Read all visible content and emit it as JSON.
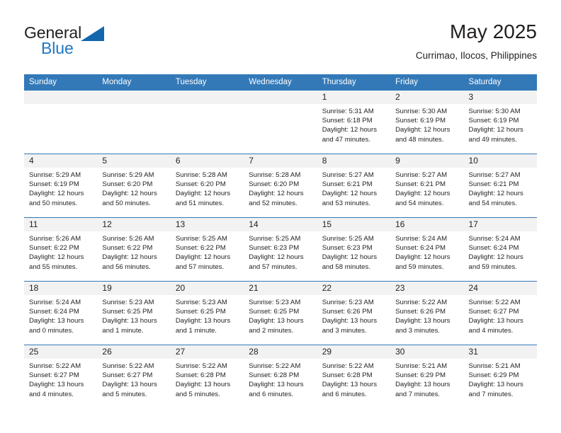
{
  "logo": {
    "word1": "General",
    "word2": "Blue",
    "accent_color": "#1267ad",
    "triangle_icon": "logo-triangle-icon"
  },
  "header": {
    "title": "May 2025",
    "subtitle": "Currimao, Ilocos, Philippines"
  },
  "calendar": {
    "header_bg": "#3379b8",
    "daynum_bg": "#f2f2f2",
    "weekday_headers": [
      "Sunday",
      "Monday",
      "Tuesday",
      "Wednesday",
      "Thursday",
      "Friday",
      "Saturday"
    ],
    "labels": {
      "sunrise": "Sunrise:",
      "sunset": "Sunset:",
      "daylight": "Daylight:"
    },
    "weeks": [
      [
        {
          "day": "",
          "empty": true
        },
        {
          "day": "",
          "empty": true
        },
        {
          "day": "",
          "empty": true
        },
        {
          "day": "",
          "empty": true
        },
        {
          "day": "1",
          "sunrise": "Sunrise: 5:31 AM",
          "sunset": "Sunset: 6:18 PM",
          "daylight1": "Daylight: 12 hours",
          "daylight2": "and 47 minutes."
        },
        {
          "day": "2",
          "sunrise": "Sunrise: 5:30 AM",
          "sunset": "Sunset: 6:19 PM",
          "daylight1": "Daylight: 12 hours",
          "daylight2": "and 48 minutes."
        },
        {
          "day": "3",
          "sunrise": "Sunrise: 5:30 AM",
          "sunset": "Sunset: 6:19 PM",
          "daylight1": "Daylight: 12 hours",
          "daylight2": "and 49 minutes."
        }
      ],
      [
        {
          "day": "4",
          "sunrise": "Sunrise: 5:29 AM",
          "sunset": "Sunset: 6:19 PM",
          "daylight1": "Daylight: 12 hours",
          "daylight2": "and 50 minutes."
        },
        {
          "day": "5",
          "sunrise": "Sunrise: 5:29 AM",
          "sunset": "Sunset: 6:20 PM",
          "daylight1": "Daylight: 12 hours",
          "daylight2": "and 50 minutes."
        },
        {
          "day": "6",
          "sunrise": "Sunrise: 5:28 AM",
          "sunset": "Sunset: 6:20 PM",
          "daylight1": "Daylight: 12 hours",
          "daylight2": "and 51 minutes."
        },
        {
          "day": "7",
          "sunrise": "Sunrise: 5:28 AM",
          "sunset": "Sunset: 6:20 PM",
          "daylight1": "Daylight: 12 hours",
          "daylight2": "and 52 minutes."
        },
        {
          "day": "8",
          "sunrise": "Sunrise: 5:27 AM",
          "sunset": "Sunset: 6:21 PM",
          "daylight1": "Daylight: 12 hours",
          "daylight2": "and 53 minutes."
        },
        {
          "day": "9",
          "sunrise": "Sunrise: 5:27 AM",
          "sunset": "Sunset: 6:21 PM",
          "daylight1": "Daylight: 12 hours",
          "daylight2": "and 54 minutes."
        },
        {
          "day": "10",
          "sunrise": "Sunrise: 5:27 AM",
          "sunset": "Sunset: 6:21 PM",
          "daylight1": "Daylight: 12 hours",
          "daylight2": "and 54 minutes."
        }
      ],
      [
        {
          "day": "11",
          "sunrise": "Sunrise: 5:26 AM",
          "sunset": "Sunset: 6:22 PM",
          "daylight1": "Daylight: 12 hours",
          "daylight2": "and 55 minutes."
        },
        {
          "day": "12",
          "sunrise": "Sunrise: 5:26 AM",
          "sunset": "Sunset: 6:22 PM",
          "daylight1": "Daylight: 12 hours",
          "daylight2": "and 56 minutes."
        },
        {
          "day": "13",
          "sunrise": "Sunrise: 5:25 AM",
          "sunset": "Sunset: 6:22 PM",
          "daylight1": "Daylight: 12 hours",
          "daylight2": "and 57 minutes."
        },
        {
          "day": "14",
          "sunrise": "Sunrise: 5:25 AM",
          "sunset": "Sunset: 6:23 PM",
          "daylight1": "Daylight: 12 hours",
          "daylight2": "and 57 minutes."
        },
        {
          "day": "15",
          "sunrise": "Sunrise: 5:25 AM",
          "sunset": "Sunset: 6:23 PM",
          "daylight1": "Daylight: 12 hours",
          "daylight2": "and 58 minutes."
        },
        {
          "day": "16",
          "sunrise": "Sunrise: 5:24 AM",
          "sunset": "Sunset: 6:24 PM",
          "daylight1": "Daylight: 12 hours",
          "daylight2": "and 59 minutes."
        },
        {
          "day": "17",
          "sunrise": "Sunrise: 5:24 AM",
          "sunset": "Sunset: 6:24 PM",
          "daylight1": "Daylight: 12 hours",
          "daylight2": "and 59 minutes."
        }
      ],
      [
        {
          "day": "18",
          "sunrise": "Sunrise: 5:24 AM",
          "sunset": "Sunset: 6:24 PM",
          "daylight1": "Daylight: 13 hours",
          "daylight2": "and 0 minutes."
        },
        {
          "day": "19",
          "sunrise": "Sunrise: 5:23 AM",
          "sunset": "Sunset: 6:25 PM",
          "daylight1": "Daylight: 13 hours",
          "daylight2": "and 1 minute."
        },
        {
          "day": "20",
          "sunrise": "Sunrise: 5:23 AM",
          "sunset": "Sunset: 6:25 PM",
          "daylight1": "Daylight: 13 hours",
          "daylight2": "and 1 minute."
        },
        {
          "day": "21",
          "sunrise": "Sunrise: 5:23 AM",
          "sunset": "Sunset: 6:25 PM",
          "daylight1": "Daylight: 13 hours",
          "daylight2": "and 2 minutes."
        },
        {
          "day": "22",
          "sunrise": "Sunrise: 5:23 AM",
          "sunset": "Sunset: 6:26 PM",
          "daylight1": "Daylight: 13 hours",
          "daylight2": "and 3 minutes."
        },
        {
          "day": "23",
          "sunrise": "Sunrise: 5:22 AM",
          "sunset": "Sunset: 6:26 PM",
          "daylight1": "Daylight: 13 hours",
          "daylight2": "and 3 minutes."
        },
        {
          "day": "24",
          "sunrise": "Sunrise: 5:22 AM",
          "sunset": "Sunset: 6:27 PM",
          "daylight1": "Daylight: 13 hours",
          "daylight2": "and 4 minutes."
        }
      ],
      [
        {
          "day": "25",
          "sunrise": "Sunrise: 5:22 AM",
          "sunset": "Sunset: 6:27 PM",
          "daylight1": "Daylight: 13 hours",
          "daylight2": "and 4 minutes."
        },
        {
          "day": "26",
          "sunrise": "Sunrise: 5:22 AM",
          "sunset": "Sunset: 6:27 PM",
          "daylight1": "Daylight: 13 hours",
          "daylight2": "and 5 minutes."
        },
        {
          "day": "27",
          "sunrise": "Sunrise: 5:22 AM",
          "sunset": "Sunset: 6:28 PM",
          "daylight1": "Daylight: 13 hours",
          "daylight2": "and 5 minutes."
        },
        {
          "day": "28",
          "sunrise": "Sunrise: 5:22 AM",
          "sunset": "Sunset: 6:28 PM",
          "daylight1": "Daylight: 13 hours",
          "daylight2": "and 6 minutes."
        },
        {
          "day": "29",
          "sunrise": "Sunrise: 5:22 AM",
          "sunset": "Sunset: 6:28 PM",
          "daylight1": "Daylight: 13 hours",
          "daylight2": "and 6 minutes."
        },
        {
          "day": "30",
          "sunrise": "Sunrise: 5:21 AM",
          "sunset": "Sunset: 6:29 PM",
          "daylight1": "Daylight: 13 hours",
          "daylight2": "and 7 minutes."
        },
        {
          "day": "31",
          "sunrise": "Sunrise: 5:21 AM",
          "sunset": "Sunset: 6:29 PM",
          "daylight1": "Daylight: 13 hours",
          "daylight2": "and 7 minutes."
        }
      ]
    ]
  }
}
